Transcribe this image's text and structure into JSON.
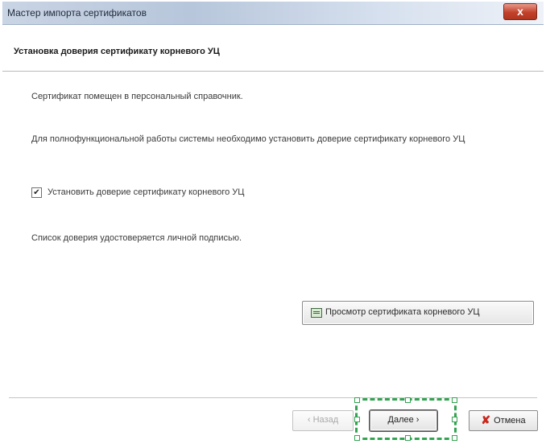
{
  "window": {
    "title": "Мастер импорта сертификатов",
    "close_label": "x"
  },
  "header": {
    "title": "Установка доверия сертификату корневого УЦ"
  },
  "body": {
    "line1": "Сертификат помещен в персональный справочник.",
    "line2": "Для полнофункциональной работы системы необходимо установить доверие сертификату корневого УЦ",
    "checkbox": {
      "label": "Установить доверие сертификату корневого УЦ",
      "checked": true,
      "mark": "✔"
    },
    "line3": "Список доверия удостоверяется личной подписью.",
    "view_button_label": "Просмотр сертификата корневого УЦ"
  },
  "footer": {
    "back_label": "‹ Назад",
    "next_label": "Далее ›",
    "cancel_label": "Отмена",
    "cancel_icon": "x-icon"
  },
  "colors": {
    "highlight": "#33a352",
    "cancel_icon": "#c8281e"
  }
}
